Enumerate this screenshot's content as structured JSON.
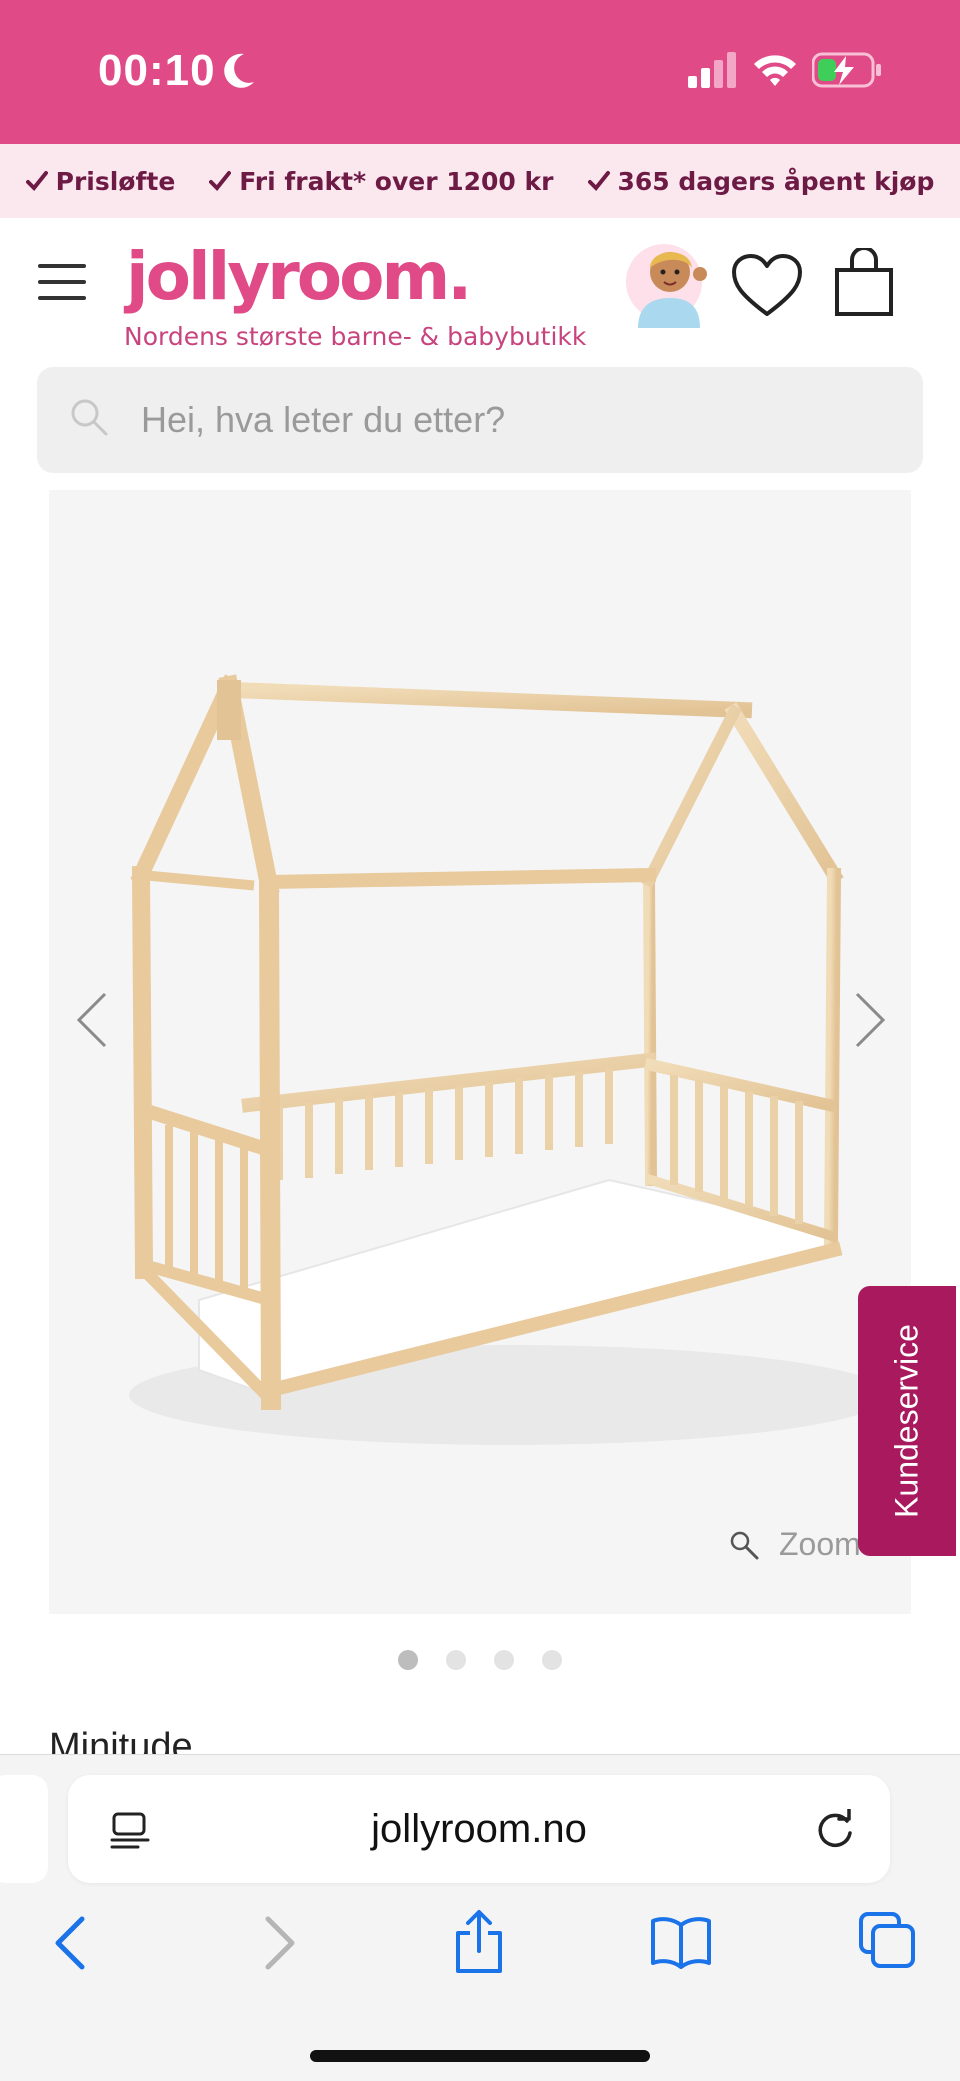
{
  "status_bar": {
    "time": "00:10",
    "icons": [
      "moon-icon",
      "cellular-signal-icon",
      "wifi-icon",
      "battery-charging-icon"
    ],
    "background": "#e04a86"
  },
  "usp": {
    "items": [
      "Prisløfte",
      "Fri frakt* over 1200 kr",
      "365 dagers åpent kjøp"
    ],
    "background": "#fbe7ee",
    "text_color": "#6d1a45"
  },
  "header": {
    "logo": "jollyroom.",
    "tagline": "Nordens største barne- & babybutikk",
    "brand_color": "#e04a86",
    "icons": [
      "menu-icon",
      "customer-avatar-icon",
      "heart-icon",
      "shopping-bag-icon"
    ]
  },
  "search": {
    "placeholder": "Hei, hva leter du etter?"
  },
  "product": {
    "image_alt": "Wooden house-frame toddler bed with slatted side rails and white mattress",
    "zoom_label": "Zoom",
    "gallery_count": 4,
    "active_index": 0,
    "title": "Minitude"
  },
  "customer_service": {
    "label": "Kundeservice",
    "color": "#a8195d"
  },
  "browser": {
    "url": "jollyroom.no",
    "toolbar_icons": [
      "back-icon",
      "forward-icon",
      "share-icon",
      "bookmarks-icon",
      "tabs-icon"
    ],
    "accent": "#1a73e8"
  }
}
